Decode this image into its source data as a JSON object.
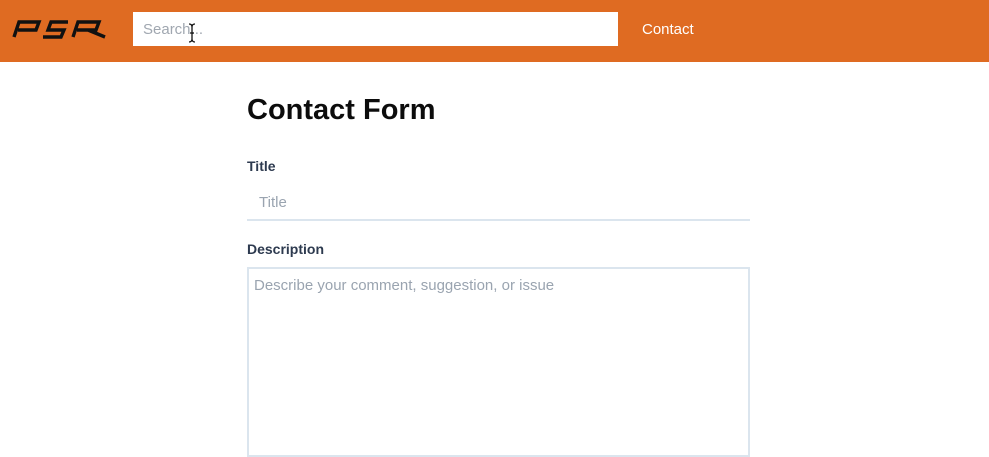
{
  "header": {
    "logo_text": "PSR",
    "search": {
      "value": "",
      "placeholder": "Search..."
    },
    "nav_links": [
      {
        "label": "Contact"
      }
    ]
  },
  "form": {
    "title": "Contact Form",
    "fields": {
      "title": {
        "label": "Title",
        "value": "",
        "placeholder": "Title"
      },
      "description": {
        "label": "Description",
        "value": "",
        "placeholder": "Describe your comment, suggestion, or issue"
      }
    }
  },
  "colors": {
    "navbar_bg": "#df6b22",
    "nav_link": "#ffffff",
    "label_text": "#2d3a4f",
    "input_border": "#dbe5ee",
    "placeholder": "#9aa4b0"
  },
  "icons": {
    "cursor": "text-cursor-icon"
  }
}
